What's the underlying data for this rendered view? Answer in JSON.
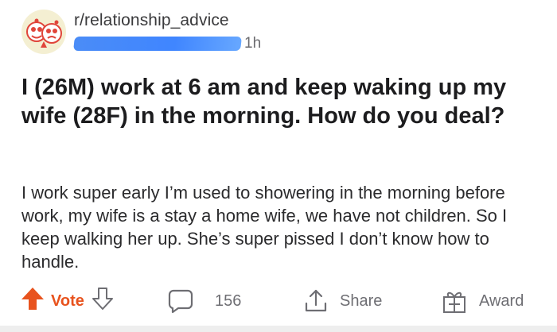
{
  "header": {
    "subreddit": "r/relationship_advice",
    "age": "1h",
    "avatar_icon": "snoo-avatar-icon"
  },
  "post": {
    "title": "I (26M) work at 6 am and keep waking up my wife (28F) in the morning. How do you deal?",
    "body": "I work super early I’m used to showering in the morning before work, my wife is a stay a home wife, we have not children. So I keep walking her up. She’s super pissed I don’t know how to handle."
  },
  "actions": {
    "vote_label": "Vote",
    "comment_count": "156",
    "share_label": "Share",
    "award_label": "Award"
  },
  "colors": {
    "upvote": "#e8531e",
    "muted": "#6e6e73",
    "redaction": "#2f7bff"
  }
}
